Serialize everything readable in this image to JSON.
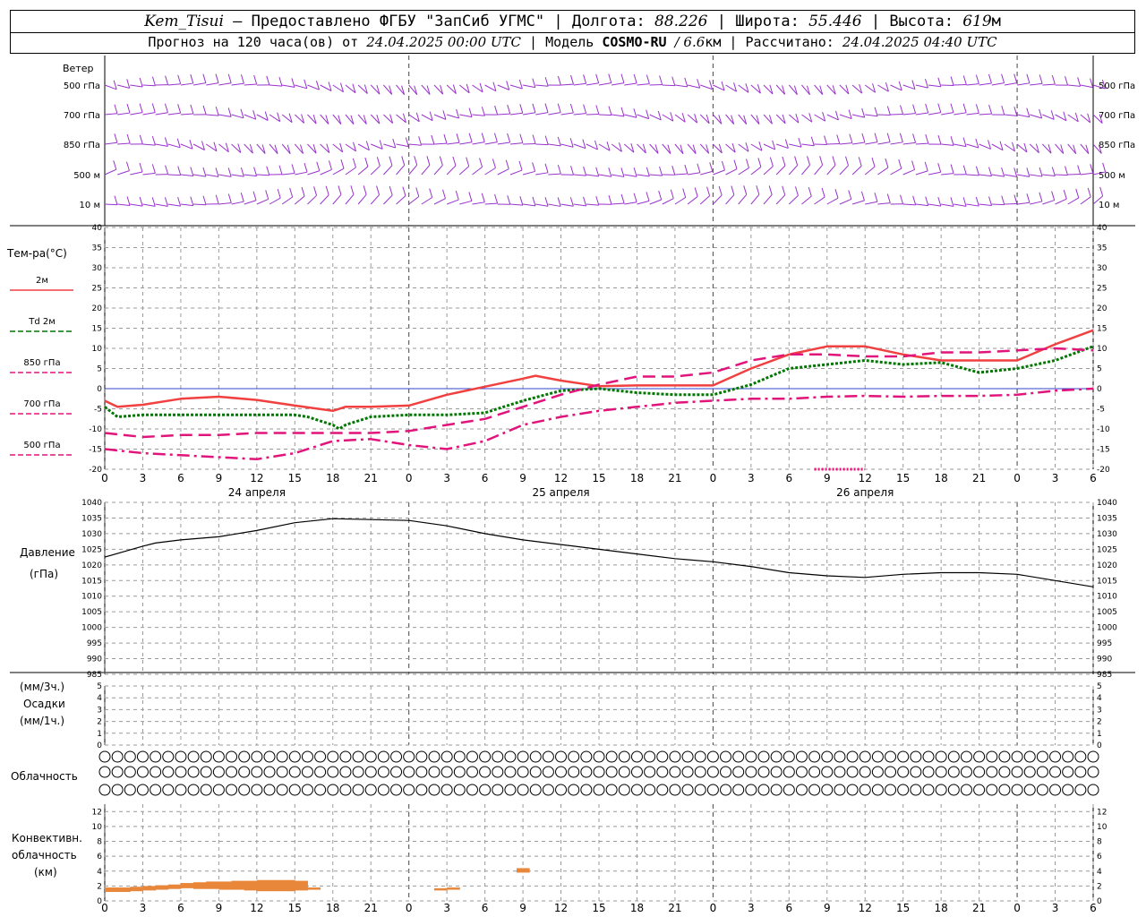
{
  "header": {
    "station": "Kem_Tisui",
    "provider": "— Предоставлено ФГБУ \"ЗапСиб УГМС\"",
    "lon_label": "Долгота:",
    "lon_value": "88.226",
    "lat_label": "Широта:",
    "lat_value": "55.446",
    "alt_label": "Высота:",
    "alt_value": "619",
    "alt_unit": "м",
    "forecast_prefix": "Прогноз на 120 часа(ов) от",
    "forecast_start": "24.04.2025 00:00 UTC",
    "model_label": "Модель",
    "model_name": "COSMO-RU",
    "model_res": "/ 6.6",
    "model_res_unit": "км",
    "calc_label": "Рассчитано:",
    "calc_time": "24.04.2025 04:40 UTC"
  },
  "colors": {
    "wind": "#9933cc",
    "t2m": "#f04040",
    "td2m": "#007700",
    "levels": "#e0147a",
    "pressure": "#000000",
    "convective": "#e8873a",
    "zero_line": "#3344cc",
    "grid": "#999999"
  },
  "chart_data": {
    "type": "line",
    "time_hours": [
      0,
      3,
      6,
      9,
      12,
      15,
      18,
      21,
      24,
      27,
      30,
      33,
      36,
      39,
      42,
      45,
      48,
      51,
      54,
      57,
      60,
      63,
      66,
      69,
      72,
      75,
      78
    ],
    "time_tick_labels": [
      "0",
      "3",
      "6",
      "9",
      "12",
      "15",
      "18",
      "21",
      "0",
      "3",
      "6",
      "9",
      "12",
      "15",
      "18",
      "21",
      "0",
      "3",
      "6",
      "9",
      "12",
      "15",
      "18",
      "21",
      "0",
      "3",
      "6"
    ],
    "day_labels": [
      {
        "hour": 12,
        "label": "24 апреля"
      },
      {
        "hour": 36,
        "label": "25 апреля"
      },
      {
        "hour": 60,
        "label": "26 апреля"
      }
    ],
    "wind": {
      "title": "Ветер",
      "levels": [
        "500 гПа",
        "700 гПа",
        "850 гПа",
        "500 м",
        "10  м"
      ],
      "note": "Wind barbs drawn every hour for each level"
    },
    "temperature": {
      "panel_label": "Тем-ра(°C)",
      "ylim": [
        -20,
        40
      ],
      "yticks": [
        40,
        35,
        30,
        25,
        20,
        15,
        10,
        5,
        0,
        -5,
        -10,
        -15,
        -20
      ],
      "series": [
        {
          "name": "2м",
          "style": "solid",
          "x": [
            0,
            1,
            3,
            6,
            9,
            12,
            15,
            18,
            19,
            21,
            24,
            27,
            30,
            33,
            34,
            36,
            39,
            42,
            45,
            48,
            51,
            54,
            57,
            60,
            63,
            66,
            69,
            72,
            75,
            78
          ],
          "values": [
            -3,
            -4.5,
            -4,
            -2.5,
            -2,
            -2.8,
            -4.2,
            -5.5,
            -4.5,
            -4.5,
            -4.2,
            -1.5,
            0.5,
            2.5,
            3.2,
            2,
            0.6,
            0.8,
            0.8,
            0.8,
            5,
            8.5,
            10.5,
            10.5,
            8.5,
            7,
            7,
            7,
            11,
            14.5
          ]
        },
        {
          "name": "Td  2м",
          "style": "dotted",
          "x": [
            0,
            1,
            3,
            6,
            9,
            12,
            15,
            16,
            17,
            18,
            18.5,
            19,
            21,
            24,
            27,
            30,
            33,
            36,
            39,
            42,
            45,
            48,
            51,
            54,
            57,
            60,
            63,
            66,
            69,
            72,
            75,
            78
          ],
          "values": [
            -4.5,
            -7,
            -6.5,
            -6.5,
            -6.5,
            -6.5,
            -6.5,
            -7,
            -8,
            -9,
            -10,
            -9,
            -7,
            -6.5,
            -6.5,
            -6,
            -3,
            -0.5,
            0,
            -1,
            -1.5,
            -1.5,
            1,
            5,
            6,
            7,
            6,
            6.5,
            4,
            5,
            7,
            10.5
          ]
        },
        {
          "name": "850 гПа",
          "style": "dashed",
          "x": [
            0,
            3,
            6,
            9,
            12,
            15,
            18,
            21,
            24,
            27,
            30,
            33,
            36,
            39,
            42,
            45,
            48,
            51,
            54,
            57,
            60,
            63,
            66,
            69,
            72,
            75,
            78
          ],
          "values": [
            -11,
            -12,
            -11.5,
            -11.5,
            -11,
            -11,
            -11,
            -11,
            -10.5,
            -9,
            -7.5,
            -4.5,
            -1.5,
            1,
            3,
            3,
            4,
            7,
            8.5,
            8.5,
            8,
            8,
            9,
            9,
            9.5,
            10,
            9.5
          ]
        },
        {
          "name": "700 гПа",
          "style": "dashdot",
          "x": [
            0,
            3,
            6,
            9,
            12,
            15,
            18,
            21,
            24,
            27,
            30,
            33,
            36,
            39,
            42,
            45,
            48,
            51,
            54,
            57,
            60,
            63,
            66,
            69,
            72,
            75,
            78
          ],
          "values": [
            -15,
            -16,
            -16.5,
            -17,
            -17.5,
            -16,
            -13,
            -12.5,
            -14,
            -15,
            -13,
            -9,
            -7,
            -5.5,
            -4.5,
            -3.5,
            -3,
            -2.5,
            -2.5,
            -2,
            -1.8,
            -2,
            -1.8,
            -1.8,
            -1.5,
            -0.5,
            0
          ]
        },
        {
          "name": "500 гПа",
          "style": "dotted-fine",
          "x": [
            56,
            57,
            58,
            59,
            60
          ],
          "values": [
            -20,
            -20,
            -20,
            -20,
            -20
          ]
        }
      ]
    },
    "pressure": {
      "panel_label": "Давление",
      "unit_label": "(гПа)",
      "ylim": [
        985,
        1040
      ],
      "yticks": [
        1040,
        1035,
        1030,
        1025,
        1020,
        1015,
        1010,
        1005,
        1000,
        995,
        990,
        985
      ],
      "x": [
        0,
        3,
        4,
        6,
        9,
        12,
        15,
        18,
        21,
        24,
        27,
        30,
        33,
        36,
        39,
        42,
        45,
        48,
        51,
        54,
        57,
        60,
        63,
        66,
        69,
        72,
        75,
        78
      ],
      "values": [
        1022.5,
        1026,
        1027,
        1028,
        1029,
        1031,
        1033.5,
        1034.8,
        1034.5,
        1034.2,
        1032.5,
        1030,
        1028,
        1026.5,
        1025,
        1023.5,
        1022,
        1021,
        1019.5,
        1017.5,
        1016.5,
        1016,
        1017,
        1017.5,
        1017.5,
        1017,
        1015,
        1013
      ]
    },
    "precipitation": {
      "panel_label_top": "(мм/3ч.)",
      "panel_label_mid": "Осадки",
      "panel_label_bot": "(мм/1ч.)",
      "ylim": [
        0,
        5
      ],
      "yticks": [
        5,
        4,
        3,
        2,
        1,
        0
      ],
      "values": []
    },
    "cloudiness": {
      "panel_label": "Облачность",
      "rows": 3,
      "hours": 79,
      "row_high": [
        0,
        0,
        0,
        0,
        0,
        0,
        0,
        0,
        0,
        0,
        0,
        0,
        0,
        0,
        0,
        0,
        0,
        0,
        0,
        0,
        0,
        0,
        0,
        0,
        0,
        0,
        0,
        0,
        0,
        0,
        0,
        0,
        0,
        0,
        0,
        0,
        0,
        0,
        0,
        0,
        0,
        0,
        0,
        0,
        0,
        0,
        0,
        0,
        0,
        0,
        0,
        0,
        0,
        0,
        0,
        0,
        0,
        0,
        0,
        0,
        0,
        0,
        0,
        0,
        0,
        0,
        0,
        0,
        0,
        0,
        0,
        0,
        0,
        0,
        0,
        0,
        0,
        0,
        0
      ],
      "row_mid": [
        0,
        0,
        0,
        0,
        0,
        0,
        0,
        0,
        0,
        0,
        0,
        0,
        0,
        0,
        0,
        0,
        0,
        0,
        0,
        0,
        0,
        0,
        0,
        0,
        0,
        0,
        0,
        0,
        0,
        0,
        0,
        0,
        0,
        0,
        0,
        0,
        0,
        0,
        0,
        0,
        0,
        0,
        0,
        0,
        0,
        0,
        0,
        0,
        0,
        0,
        0,
        0,
        0,
        0,
        0,
        0,
        0,
        0,
        0,
        0,
        0,
        0,
        0,
        0,
        0,
        0,
        0,
        0,
        0,
        0,
        0,
        0,
        0,
        0,
        0,
        0,
        0,
        0,
        0
      ],
      "row_low": [
        0,
        0,
        0,
        0,
        0,
        0,
        0,
        0,
        0,
        0,
        0,
        0,
        0,
        0,
        0,
        0,
        0,
        0,
        0,
        0,
        0,
        0,
        0,
        0,
        0,
        0,
        0,
        0,
        0,
        0,
        0,
        0,
        0,
        0,
        0,
        0,
        0,
        0,
        0,
        0,
        0,
        0,
        0,
        0,
        0,
        0,
        0,
        0,
        0,
        0,
        0,
        0,
        0,
        0,
        0,
        0,
        0,
        0,
        0,
        0,
        0,
        0,
        0,
        0,
        0,
        0,
        0,
        0,
        0,
        0,
        0,
        0,
        0,
        0,
        0,
        0,
        0,
        0,
        0
      ]
    },
    "convective": {
      "panel_label_1": "Конвективн.",
      "panel_label_2": "облачность",
      "panel_label_3": "(км)",
      "ylim": [
        0,
        13
      ],
      "yticks": [
        12,
        10,
        8,
        6,
        4,
        2,
        0
      ],
      "segments": [
        {
          "h0": 0,
          "h1": 1,
          "base": 1.2,
          "top": 1.8
        },
        {
          "h0": 1,
          "h1": 2,
          "base": 1.2,
          "top": 1.8
        },
        {
          "h0": 2,
          "h1": 3,
          "base": 1.3,
          "top": 1.9
        },
        {
          "h0": 3,
          "h1": 4,
          "base": 1.4,
          "top": 2.0
        },
        {
          "h0": 4,
          "h1": 5,
          "base": 1.5,
          "top": 2.1
        },
        {
          "h0": 5,
          "h1": 6,
          "base": 1.6,
          "top": 2.2
        },
        {
          "h0": 6,
          "h1": 7,
          "base": 1.7,
          "top": 2.4
        },
        {
          "h0": 7,
          "h1": 8,
          "base": 1.6,
          "top": 2.5
        },
        {
          "h0": 8,
          "h1": 9,
          "base": 1.6,
          "top": 2.6
        },
        {
          "h0": 9,
          "h1": 10,
          "base": 1.5,
          "top": 2.6
        },
        {
          "h0": 10,
          "h1": 11,
          "base": 1.5,
          "top": 2.7
        },
        {
          "h0": 11,
          "h1": 12,
          "base": 1.4,
          "top": 2.7
        },
        {
          "h0": 12,
          "h1": 13,
          "base": 1.3,
          "top": 2.8
        },
        {
          "h0": 13,
          "h1": 14,
          "base": 1.3,
          "top": 2.8
        },
        {
          "h0": 14,
          "h1": 15,
          "base": 1.3,
          "top": 2.8
        },
        {
          "h0": 15,
          "h1": 16,
          "base": 1.4,
          "top": 2.7
        },
        {
          "h0": 16,
          "h1": 17,
          "base": 1.5,
          "top": 1.8
        },
        {
          "h0": 26,
          "h1": 27,
          "base": 1.4,
          "top": 1.7
        },
        {
          "h0": 27,
          "h1": 28,
          "base": 1.5,
          "top": 1.8
        },
        {
          "h0": 32.5,
          "h1": 33.5,
          "base": 3.8,
          "top": 4.4
        }
      ]
    }
  }
}
